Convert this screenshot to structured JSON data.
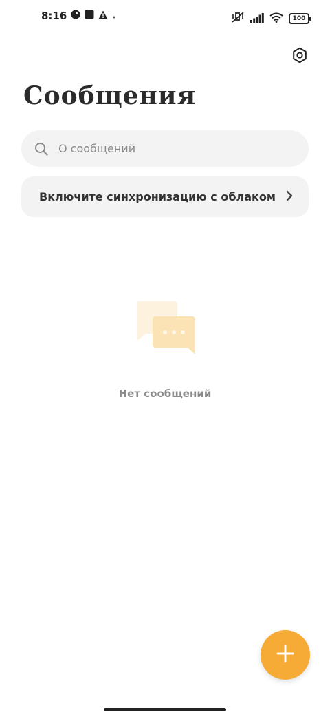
{
  "status_bar": {
    "time": "8:16",
    "battery": "100"
  },
  "header": {
    "title": "Сообщения"
  },
  "search": {
    "placeholder": "О сообщений"
  },
  "sync_banner": {
    "label": "Включите синхронизацию с облаком"
  },
  "empty_state": {
    "text": "Нет сообщений"
  },
  "colors": {
    "accent": "#f6ab36",
    "card_bg": "#f3f3f3",
    "illustration_back": "#fdf2dd",
    "illustration_front": "#fbe3b5"
  },
  "icons": {
    "settings": "settings-icon",
    "search": "search-icon",
    "chevron": "chevron-right-icon",
    "fab": "plus-icon"
  }
}
